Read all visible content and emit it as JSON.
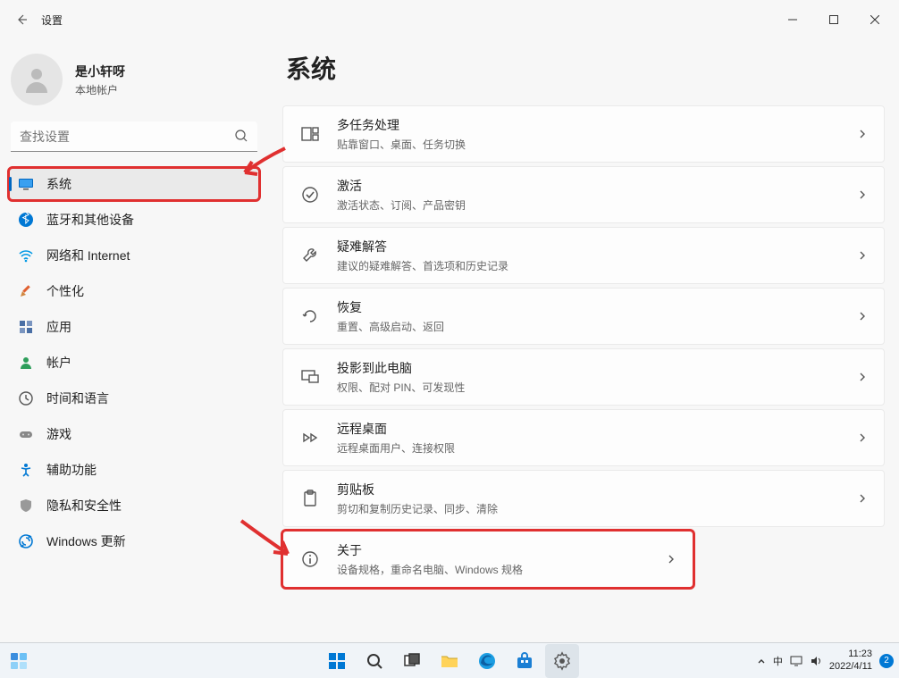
{
  "app_title": "设置",
  "user": {
    "name": "是小轩呀",
    "subtitle": "本地帐户"
  },
  "search": {
    "placeholder": "查找设置"
  },
  "nav": [
    {
      "key": "system",
      "label": "系统",
      "active": true,
      "highlighted": true
    },
    {
      "key": "bluetooth",
      "label": "蓝牙和其他设备"
    },
    {
      "key": "network",
      "label": "网络和 Internet"
    },
    {
      "key": "personalization",
      "label": "个性化"
    },
    {
      "key": "apps",
      "label": "应用"
    },
    {
      "key": "accounts",
      "label": "帐户"
    },
    {
      "key": "time",
      "label": "时间和语言"
    },
    {
      "key": "gaming",
      "label": "游戏"
    },
    {
      "key": "accessibility",
      "label": "辅助功能"
    },
    {
      "key": "privacy",
      "label": "隐私和安全性"
    },
    {
      "key": "update",
      "label": "Windows 更新"
    }
  ],
  "page_title": "系统",
  "cards": [
    {
      "key": "multitask",
      "title": "多任务处理",
      "sub": "贴靠窗口、桌面、任务切换"
    },
    {
      "key": "activation",
      "title": "激活",
      "sub": "激活状态、订阅、产品密钥"
    },
    {
      "key": "troubleshoot",
      "title": "疑难解答",
      "sub": "建议的疑难解答、首选项和历史记录"
    },
    {
      "key": "recovery",
      "title": "恢复",
      "sub": "重置、高级启动、返回"
    },
    {
      "key": "project",
      "title": "投影到此电脑",
      "sub": "权限、配对 PIN、可发现性"
    },
    {
      "key": "remote",
      "title": "远程桌面",
      "sub": "远程桌面用户、连接权限"
    },
    {
      "key": "clipboard",
      "title": "剪贴板",
      "sub": "剪切和复制历史记录、同步、清除"
    },
    {
      "key": "about",
      "title": "关于",
      "sub": "设备规格，重命名电脑、Windows 规格",
      "highlighted": true
    }
  ],
  "taskbar": {
    "ime": "中",
    "time": "11:23",
    "date": "2022/4/11",
    "notif_count": "2"
  }
}
